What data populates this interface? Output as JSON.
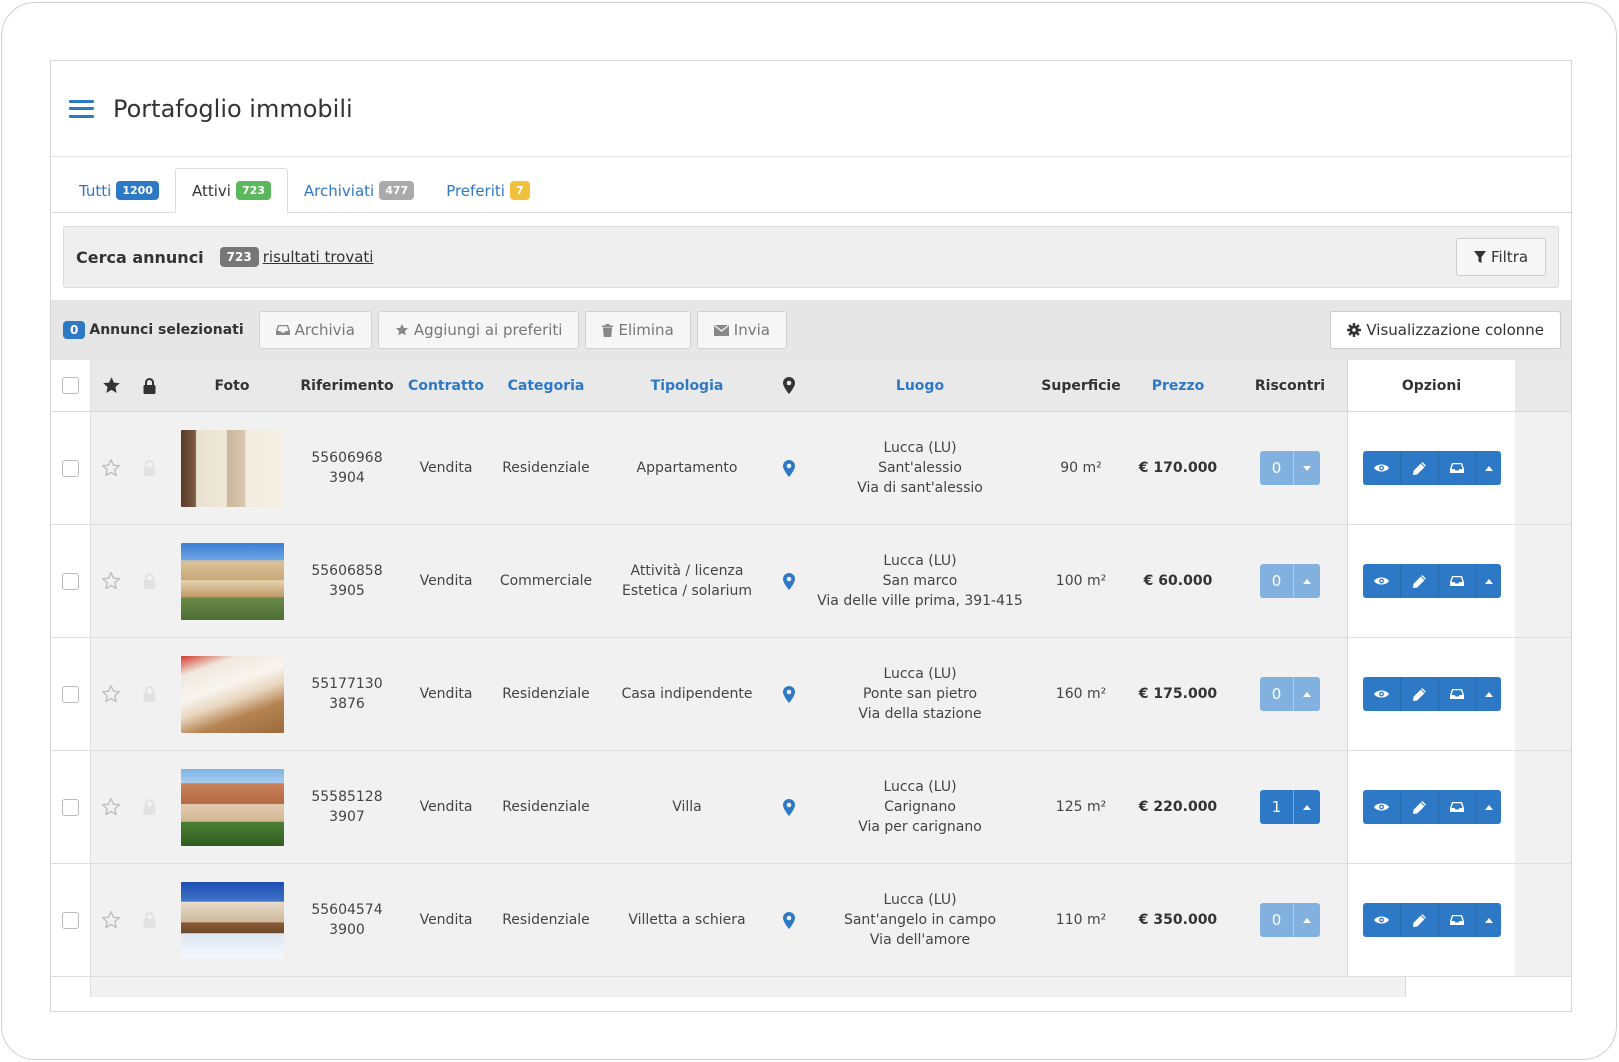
{
  "header": {
    "title": "Portafoglio immobili"
  },
  "tabs": [
    {
      "label": "Tutti",
      "count": "1200",
      "color": "#2e79c6"
    },
    {
      "label": "Attivi",
      "count": "723",
      "color": "#5cb85c",
      "active": true
    },
    {
      "label": "Archiviati",
      "count": "477",
      "color": "#aaaaaa"
    },
    {
      "label": "Preferiti",
      "count": "7",
      "color": "#f0c23b"
    }
  ],
  "search": {
    "title": "Cerca annunci",
    "count": "723",
    "results_label": "risultati trovati",
    "filter_label": "Filtra"
  },
  "actions": {
    "selected_count": "0",
    "selected_label": "Annunci selezionati",
    "archive_label": "Archivia",
    "favorite_label": "Aggiungi ai preferiti",
    "delete_label": "Elimina",
    "send_label": "Invia",
    "columns_label": "Visualizzazione colonne"
  },
  "columns": {
    "foto": "Foto",
    "riferimento": "Riferimento",
    "contratto": "Contratto",
    "categoria": "Categoria",
    "tipologia": "Tipologia",
    "luogo": "Luogo",
    "superficie": "Superficie",
    "prezzo": "Prezzo",
    "riscontri": "Riscontri",
    "opzioni": "Opzioni"
  },
  "rows": [
    {
      "ref1": "55606968",
      "ref2": "3904",
      "contratto": "Vendita",
      "categoria": "Residenziale",
      "tip1": "Appartamento",
      "tip2": "",
      "luogo1": "Lucca (LU)",
      "luogo2": "Sant'alessio",
      "luogo3": "Via di sant'alessio",
      "superficie": "90 m²",
      "prezzo": "€ 170.000",
      "riscontri": "0",
      "photo": "interior"
    },
    {
      "ref1": "55606858",
      "ref2": "3905",
      "contratto": "Vendita",
      "categoria": "Commerciale",
      "tip1": "Attività / licenza",
      "tip2": "Estetica / solarium",
      "luogo1": "Lucca (LU)",
      "luogo2": "San marco",
      "luogo3": "Via delle ville prima, 391-415",
      "superficie": "100 m²",
      "prezzo": "€ 60.000",
      "riscontri": "0",
      "photo": "building"
    },
    {
      "ref1": "55177130",
      "ref2": "3876",
      "contratto": "Vendita",
      "categoria": "Residenziale",
      "tip1": "Casa indipendente",
      "tip2": "",
      "luogo1": "Lucca (LU)",
      "luogo2": "Ponte san pietro",
      "luogo3": "Via della stazione",
      "superficie": "160 m²",
      "prezzo": "€ 175.000",
      "riscontri": "0",
      "photo": "dining"
    },
    {
      "ref1": "55585128",
      "ref2": "3907",
      "contratto": "Vendita",
      "categoria": "Residenziale",
      "tip1": "Villa",
      "tip2": "",
      "luogo1": "Lucca (LU)",
      "luogo2": "Carignano",
      "luogo3": "Via per carignano",
      "superficie": "125 m²",
      "prezzo": "€ 220.000",
      "riscontri": "1",
      "photo": "villa"
    },
    {
      "ref1": "55604574",
      "ref2": "3900",
      "contratto": "Vendita",
      "categoria": "Residenziale",
      "tip1": "Villetta a schiera",
      "tip2": "",
      "luogo1": "Lucca (LU)",
      "luogo2": "Sant'angelo in campo",
      "luogo3": "Via dell'amore",
      "superficie": "110 m²",
      "prezzo": "€ 350.000",
      "riscontri": "0",
      "photo": "snow"
    }
  ],
  "icons": {
    "menu": "hamburger-icon",
    "filter": "filter-icon",
    "archive": "inbox-icon",
    "favorite": "star-icon",
    "delete": "trash-icon",
    "send": "envelope-icon",
    "columns": "gear-icon",
    "pin": "map-pin-icon",
    "lock": "lock-icon",
    "view": "eye-icon",
    "edit": "pencil-icon",
    "caret": "caret-icon"
  },
  "colors": {
    "accent": "#2e79c6",
    "accent_light": "#82b1e0",
    "panel": "#efefef",
    "row": "#f1f1f1"
  }
}
